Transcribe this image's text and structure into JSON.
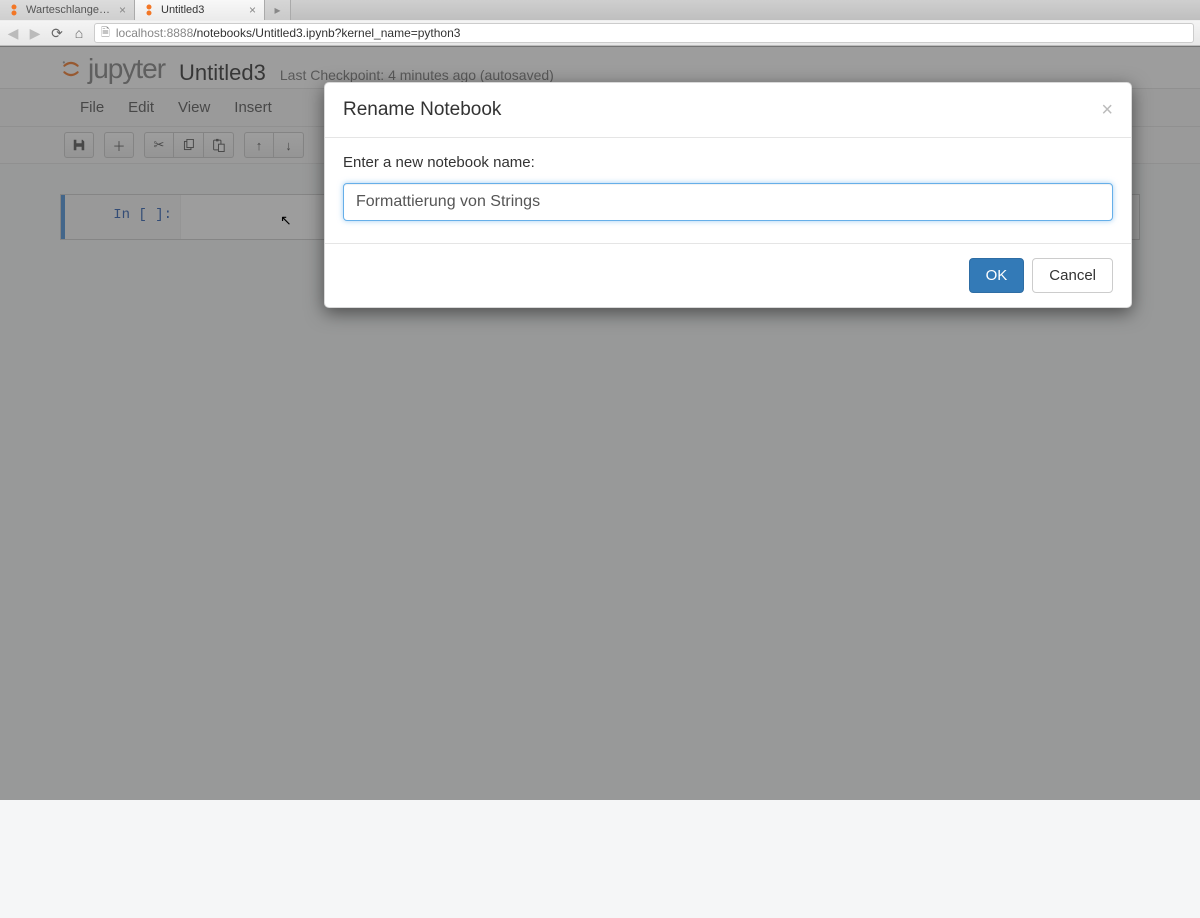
{
  "browser": {
    "tabs": [
      {
        "title": "Warteschlange Uebu",
        "active": false,
        "favicon": "jupyter"
      },
      {
        "title": "Untitled3",
        "active": true,
        "favicon": "jupyter"
      }
    ],
    "url_host": "localhost",
    "url_port": ":8888",
    "url_path": "/notebooks/Untitled3.ipynb?kernel_name=python3"
  },
  "header": {
    "logo_text": "jupyter",
    "notebook_name": "Untitled3",
    "checkpoint_text": "Last Checkpoint: 4 minutes ago (autosaved)"
  },
  "menu": {
    "items": [
      "File",
      "Edit",
      "View",
      "Insert"
    ]
  },
  "toolbar": {
    "icons": [
      "save-icon",
      "add-icon",
      "cut-icon",
      "copy-icon",
      "paste-icon",
      "move-up-icon",
      "move-down-icon"
    ]
  },
  "cell": {
    "prompt": "In [ ]:"
  },
  "modal": {
    "title": "Rename Notebook",
    "prompt": "Enter a new notebook name:",
    "input_value": "Formattierung von Strings",
    "ok_label": "OK",
    "cancel_label": "Cancel"
  },
  "colors": {
    "primary": "#337ab7",
    "focus_border": "#66afe9",
    "cell_gutter": "#4a90d9"
  }
}
